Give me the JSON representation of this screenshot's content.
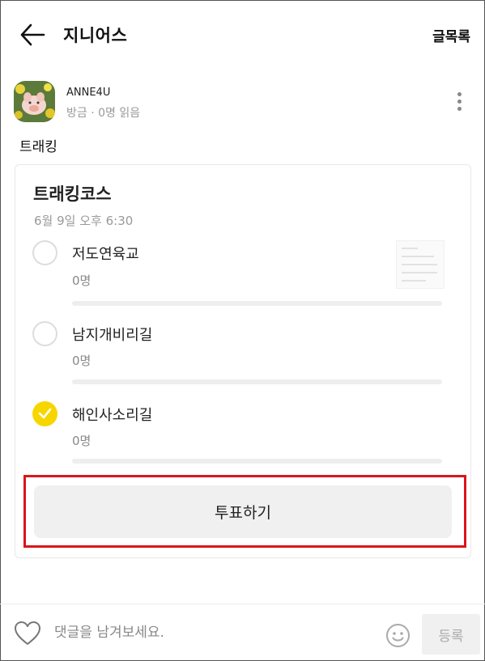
{
  "header": {
    "title": "지니어스",
    "list_label": "글목록"
  },
  "author": {
    "name": "ANNE4U",
    "meta": "방금 · 0명 읽음"
  },
  "post": {
    "text": "트래킹"
  },
  "poll": {
    "title": "트래킹코스",
    "date": "6월 9일 오후 6:30",
    "options": [
      {
        "label": "저도연육교",
        "count": "0명",
        "checked": false
      },
      {
        "label": "남지개비리길",
        "count": "0명",
        "checked": false
      },
      {
        "label": "해인사소리길",
        "count": "0명",
        "checked": true
      }
    ],
    "vote_label": "투표하기",
    "accent_color": "#f7d600"
  },
  "comment": {
    "placeholder": "댓글을 남겨보세요.",
    "submit_label": "등록"
  },
  "colors": {
    "highlight": "#d9151c",
    "selected": "#f7d600"
  }
}
